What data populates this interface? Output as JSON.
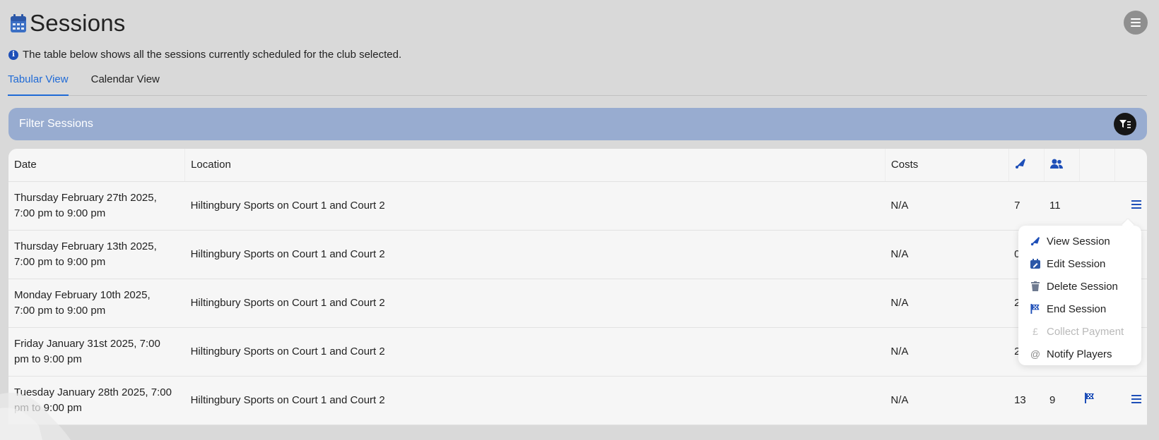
{
  "header": {
    "title": "Sessions",
    "icon": "calendar-icon"
  },
  "info": {
    "text": "The table below shows all the sessions currently scheduled for the club selected.",
    "icon": "info-icon"
  },
  "tabs": [
    {
      "label": "Tabular View",
      "active": true
    },
    {
      "label": "Calendar View",
      "active": false
    }
  ],
  "filter": {
    "title": "Filter Sessions",
    "icon": "filter-icon"
  },
  "table": {
    "headers": {
      "date": "Date",
      "location": "Location",
      "costs": "Costs",
      "shuttle_icon": "shuttlecock-icon",
      "players_icon": "users-icon"
    },
    "rows": [
      {
        "date_line1": "Thursday February 27th 2025,",
        "date_line2": "7:00 pm to 9:00 pm",
        "location": "Hiltingbury Sports on Court 1 and Court 2",
        "costs": "N/A",
        "n1": "7",
        "n2": "11"
      },
      {
        "date_line1": "Thursday February 13th 2025,",
        "date_line2": "7:00 pm to 9:00 pm",
        "location": "Hiltingbury Sports on Court 1 and Court 2",
        "costs": "N/A",
        "n1": "0",
        "n2": ""
      },
      {
        "date_line1": "Monday February 10th 2025,",
        "date_line2": "7:00 pm to 9:00 pm",
        "location": "Hiltingbury Sports on Court 1 and Court 2",
        "costs": "N/A",
        "n1": "2",
        "n2": ""
      },
      {
        "date_line1": "Friday January 31st 2025, 7:00",
        "date_line2": "pm to 9:00 pm",
        "location": "Hiltingbury Sports on Court 1 and Court 2",
        "costs": "N/A",
        "n1": "2",
        "n2": ""
      },
      {
        "date_line1": "Tuesday January 28th 2025, 7:00",
        "date_line2": "pm to 9:00 pm",
        "location": "Hiltingbury Sports on Court 1 and Court 2",
        "costs": "N/A",
        "n1": "13",
        "n2": "9"
      }
    ]
  },
  "dropdown": {
    "items": [
      {
        "label": "View Session",
        "icon": "shuttlecock-icon"
      },
      {
        "label": "Edit Session",
        "icon": "calendar-edit-icon"
      },
      {
        "label": "Delete Session",
        "icon": "trash-icon"
      },
      {
        "label": "End Session",
        "icon": "flag-icon"
      },
      {
        "label": "Collect Payment",
        "icon": "pound-icon",
        "disabled": true
      },
      {
        "label": "Notify Players",
        "icon": "at-icon"
      }
    ]
  },
  "colors": {
    "accent": "#1f6ad6",
    "icon_blue": "#1e4fb8",
    "filter_bg": "#98acd0",
    "page_bg": "#d9d9d9"
  }
}
